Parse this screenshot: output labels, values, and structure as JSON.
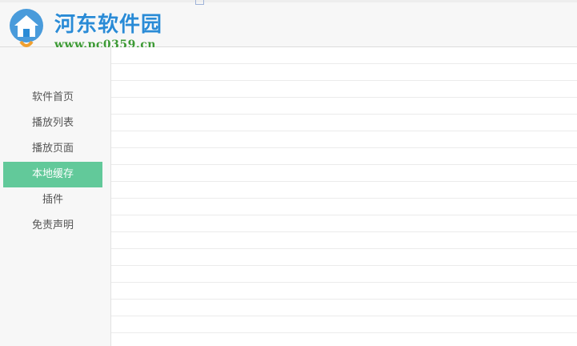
{
  "watermark": {
    "title": "河东软件园",
    "url": "www.pc0359.cn"
  },
  "sidebar": {
    "items": [
      {
        "label": "软件首页",
        "active": false
      },
      {
        "label": "播放列表",
        "active": false
      },
      {
        "label": "播放页面",
        "active": false
      },
      {
        "label": "本地缓存",
        "active": true
      },
      {
        "label": "插件",
        "active": false
      },
      {
        "label": "免责声明",
        "active": false
      }
    ]
  },
  "colors": {
    "accent": "#62c99a",
    "sidebar_bg": "#f7f7f7",
    "row_border": "#ebebeb"
  },
  "main": {
    "row_count": 18
  }
}
